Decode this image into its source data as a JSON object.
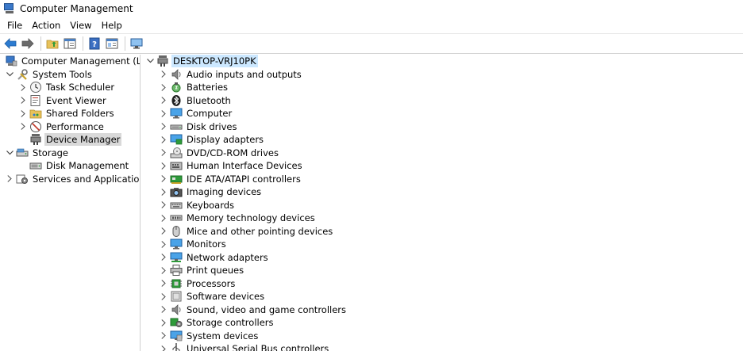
{
  "window": {
    "title": "Computer Management"
  },
  "menu": [
    "File",
    "Action",
    "View",
    "Help"
  ],
  "toolbar": {
    "icons": [
      "back-arrow-icon",
      "forward-arrow-icon",
      "up-folder-icon",
      "show-hide-tree-icon",
      "help-icon",
      "properties-icon",
      "monitor-icon"
    ]
  },
  "left_tree": [
    {
      "label": "Computer Management (Local",
      "icon": "computer-management-icon",
      "chevron": "none",
      "depth": 0
    },
    {
      "label": "System Tools",
      "icon": "tools-icon",
      "chevron": "expanded",
      "depth": 1
    },
    {
      "label": "Task Scheduler",
      "icon": "clock-icon",
      "chevron": "collapsed",
      "depth": 2
    },
    {
      "label": "Event Viewer",
      "icon": "event-viewer-icon",
      "chevron": "collapsed",
      "depth": 2
    },
    {
      "label": "Shared Folders",
      "icon": "shared-folder-icon",
      "chevron": "collapsed",
      "depth": 2
    },
    {
      "label": "Performance",
      "icon": "performance-icon",
      "chevron": "collapsed",
      "depth": 2
    },
    {
      "label": "Device Manager",
      "icon": "device-manager-icon",
      "chevron": "none",
      "depth": 2,
      "selected": true
    },
    {
      "label": "Storage",
      "icon": "storage-icon",
      "chevron": "expanded",
      "depth": 1
    },
    {
      "label": "Disk Management",
      "icon": "disk-management-icon",
      "chevron": "none",
      "depth": 2
    },
    {
      "label": "Services and Applications",
      "icon": "services-icon",
      "chevron": "collapsed",
      "depth": 1
    }
  ],
  "device_tree": {
    "root": {
      "label": "DESKTOP-VRJ10PK",
      "icon": "computer-root-icon"
    },
    "categories": [
      {
        "label": "Audio inputs and outputs",
        "icon": "speaker-icon"
      },
      {
        "label": "Batteries",
        "icon": "battery-icon"
      },
      {
        "label": "Bluetooth",
        "icon": "bluetooth-icon"
      },
      {
        "label": "Computer",
        "icon": "computer-icon"
      },
      {
        "label": "Disk drives",
        "icon": "disk-drive-icon"
      },
      {
        "label": "Display adapters",
        "icon": "display-adapter-icon"
      },
      {
        "label": "DVD/CD-ROM drives",
        "icon": "dvd-icon"
      },
      {
        "label": "Human Interface Devices",
        "icon": "hid-icon"
      },
      {
        "label": "IDE ATA/ATAPI controllers",
        "icon": "ide-controller-icon"
      },
      {
        "label": "Imaging devices",
        "icon": "camera-icon"
      },
      {
        "label": "Keyboards",
        "icon": "keyboard-icon"
      },
      {
        "label": "Memory technology devices",
        "icon": "memory-icon"
      },
      {
        "label": "Mice and other pointing devices",
        "icon": "mouse-icon"
      },
      {
        "label": "Monitors",
        "icon": "monitor-icon"
      },
      {
        "label": "Network adapters",
        "icon": "network-adapter-icon"
      },
      {
        "label": "Print queues",
        "icon": "printer-icon"
      },
      {
        "label": "Processors",
        "icon": "processor-icon"
      },
      {
        "label": "Software devices",
        "icon": "software-device-icon"
      },
      {
        "label": "Sound, video and game controllers",
        "icon": "sound-icon"
      },
      {
        "label": "Storage controllers",
        "icon": "storage-controller-icon"
      },
      {
        "label": "System devices",
        "icon": "system-device-icon"
      },
      {
        "label": "Universal Serial Bus controllers",
        "icon": "usb-icon"
      }
    ]
  }
}
